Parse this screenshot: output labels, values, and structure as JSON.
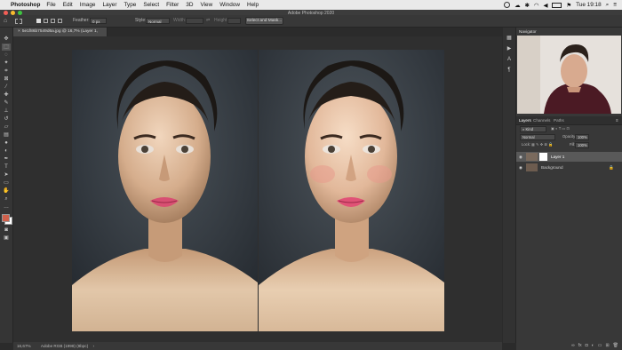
{
  "menubar": {
    "app_name": "Photoshop",
    "items": [
      "File",
      "Edit",
      "Image",
      "Layer",
      "Type",
      "Select",
      "Filter",
      "3D",
      "View",
      "Window",
      "Help"
    ],
    "clock": "Tue 19:18"
  },
  "window": {
    "title": "Adobe Photoshop 2020"
  },
  "options_bar": {
    "feather_label": "Feather:",
    "feather_value": "0 px",
    "style_label": "Style:",
    "style_value": "Normal",
    "width_label": "Width:",
    "height_label": "Height:",
    "select_mask_button": "Select and Mask..."
  },
  "document": {
    "tab_title": "5e1f86b7549d6a.jpg @ 16,7% (Layer 1, RGB/8*)",
    "zoom": "16,67%",
    "color_profile": "Adobe RGB (1998) (8bpc)"
  },
  "panels": {
    "navigator_tab": "Navigator",
    "layers_tabs": [
      "Layers",
      "Channels",
      "Paths"
    ],
    "kind_filter": "Kind",
    "blend_mode": "Normal",
    "opacity_label": "Opacity:",
    "opacity_value": "100%",
    "lock_label": "Lock:",
    "fill_label": "Fill:",
    "fill_value": "100%",
    "layers": [
      {
        "name": "Layer 1",
        "selected": true
      },
      {
        "name": "Background",
        "selected": false
      }
    ]
  },
  "colors": {
    "foreground": "#d0604b",
    "background": "#ffffff",
    "accent": "#4a78c2"
  }
}
